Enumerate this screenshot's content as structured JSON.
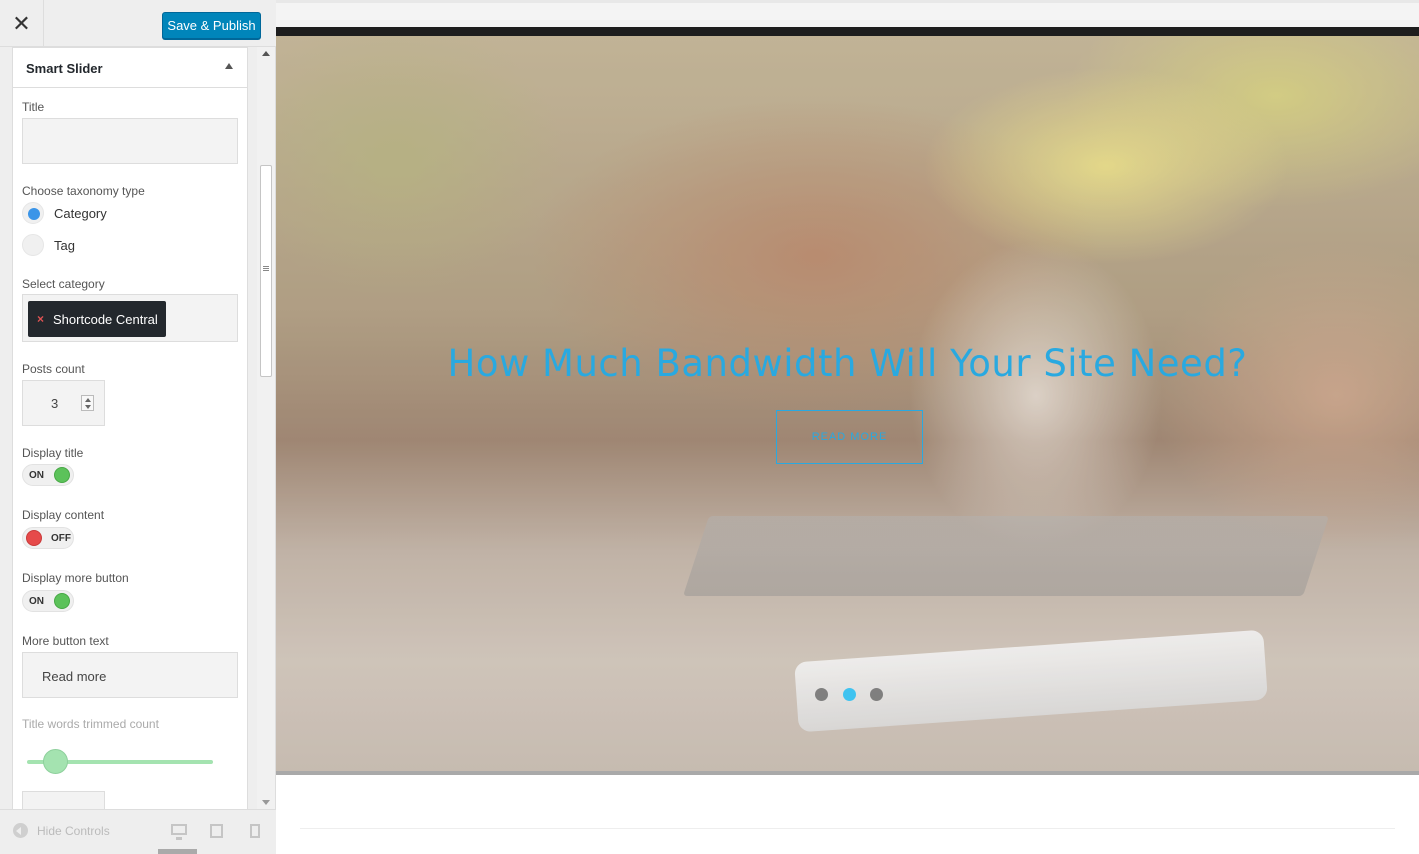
{
  "header": {
    "close_icon": "close-icon",
    "publish_label": "Save & Publish"
  },
  "panel": {
    "title": "Smart Slider",
    "fields": {
      "title_label": "Title",
      "title_value": "",
      "taxonomy_label": "Choose taxonomy type",
      "taxonomy_options": [
        {
          "label": "Category",
          "checked": true
        },
        {
          "label": "Tag",
          "checked": false
        }
      ],
      "select_category_label": "Select category",
      "selected_category": "Shortcode Central",
      "chip_remove": "×",
      "posts_count_label": "Posts count",
      "posts_count_value": "3",
      "display_title_label": "Display title",
      "display_title_state": "ON",
      "display_content_label": "Display content",
      "display_content_state": "OFF",
      "display_more_label": "Display more button",
      "display_more_state": "ON",
      "more_text_label": "More button text",
      "more_text_value": "Read more",
      "trim_label": "Title words trimmed count"
    }
  },
  "footer": {
    "hide_label": "Hide Controls",
    "devices": [
      "desktop-icon",
      "tablet-icon",
      "mobile-icon"
    ],
    "active_device": "desktop"
  },
  "preview": {
    "slide_title": "How Much Bandwidth Will Your Site Need?",
    "read_more_label": "READ MORE",
    "slide_count": 3,
    "active_slide": 2,
    "accent_color": "#29a9e0"
  },
  "colors": {
    "publish_button": "#0085ba",
    "toggle_on": "#5cc25a",
    "toggle_off": "#e64a4a",
    "radio_checked": "#3b95e8",
    "slider": "#a4e3b0"
  }
}
